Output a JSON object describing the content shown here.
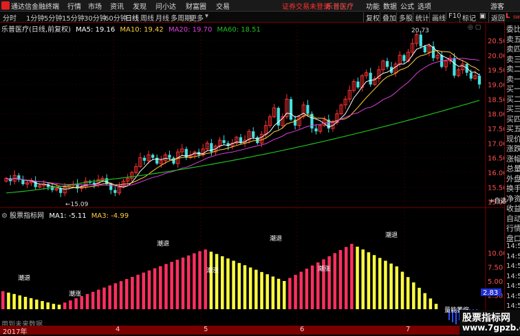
{
  "menu": {
    "app_title": "通达信金融终端",
    "items": [
      "行情",
      "市场",
      "资讯",
      "发现",
      "问小达",
      "财富圈",
      "交易"
    ],
    "warning": "证券交易未登录",
    "stock_name": "乐普医疗",
    "right_items": [
      "功能",
      "数据",
      "公式",
      "选项",
      "游客"
    ]
  },
  "periods": [
    "分时",
    "1分钟",
    "5分钟",
    "15分钟",
    "30分钟",
    "60分钟",
    "日线",
    "周线",
    "月线",
    "多周期",
    "更多"
  ],
  "active_period": "日线",
  "right_buttons": [
    "复权",
    "叠加",
    "多股",
    "统计",
    "画线",
    "F10",
    "标记",
    "返回"
  ],
  "main_info": {
    "label": "乐普医疗(日线,前复权)",
    "ma5": "MA5: 19.16",
    "ma10": "MA10: 19.42",
    "ma20": "MA20: 19.70",
    "ma60": "MA60: 18.51"
  },
  "sub_info": {
    "label": "股票指标网",
    "ma1": "MA1: -5.11",
    "ma3": "MA3: -4.99"
  },
  "price_axis": [
    "20.50",
    "20.00",
    "19.50",
    "19.00",
    "18.50",
    "18.00",
    "17.50",
    "17.00",
    "16.50",
    "16.00",
    "15.50",
    "15.00"
  ],
  "sub_axis": [
    "10.00",
    "7.50",
    "5.00",
    "2.50",
    "2.83"
  ],
  "annotations": {
    "high": "20.73",
    "low": "15.09",
    "sub_labels": [
      "潮退",
      "潮涨",
      "潮退",
      "潮涨",
      "潮退",
      "潮涨",
      "潮退",
      "量能萎缩"
    ]
  },
  "right_panel": [
    "委比",
    "卖五",
    "卖四",
    "卖三",
    "卖二",
    "卖一",
    "买一",
    "买二",
    "买三",
    "买四",
    "买五",
    "现价",
    "涨跌",
    "涨幅",
    "总量",
    "外盘",
    "换手",
    "净资",
    "收益",
    "自动",
    "行情",
    "盘口",
    "14:50",
    "14:50",
    "14:50",
    "14:50",
    "14:50",
    "14:50",
    "14:50",
    "14:50"
  ],
  "right_labels": {
    "top": "L",
    "sub": "SW",
    "side": "+自选"
  },
  "no_data": "用到未来数据",
  "date_axis": {
    "year": "2017年",
    "marks": [
      "4",
      "5",
      "6",
      "7"
    ]
  },
  "watermark": {
    "line1": "股票指标网",
    "line2": "www.7gpzb.com"
  },
  "colors": {
    "up": "#ff3030",
    "down": "#44e0e0",
    "ma5": "#ffffff",
    "ma10": "#ffd040",
    "ma20": "#e040e0",
    "ma60": "#20c020",
    "yellow": "#ffff40",
    "pink": "#ff3060",
    "blue": "#3050ff"
  }
}
